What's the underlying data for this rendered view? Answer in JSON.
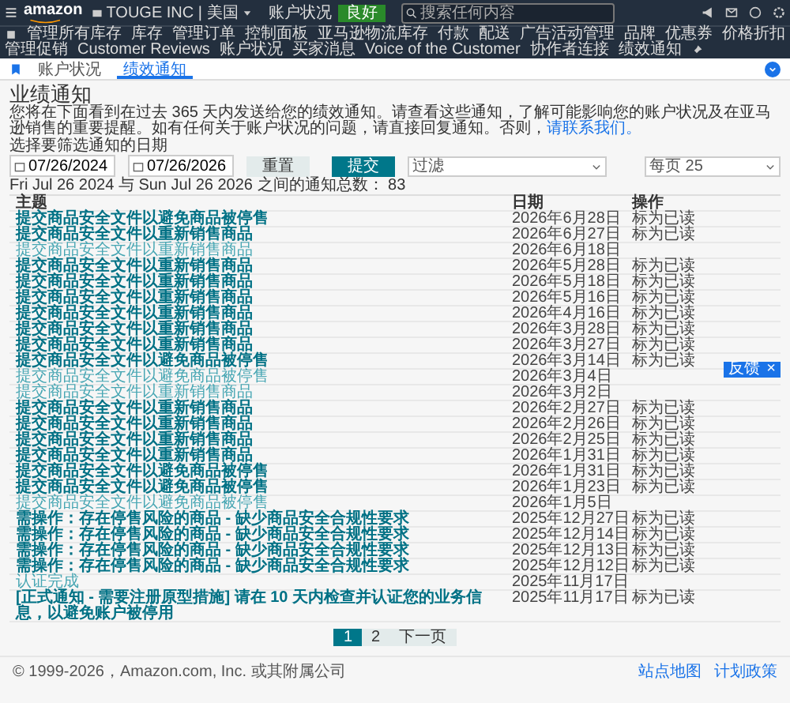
{
  "topbar": {
    "logo": "amazon",
    "store": "TOUGE INC | 美国",
    "health_label": "账户状况",
    "health_badge": "良好",
    "search": {
      "placeholder": "搜索任何内容"
    }
  },
  "nav": [
    "管理所有库存",
    "库存",
    "管理订单",
    "控制面板",
    "亚马逊物流库存",
    "付款",
    "配送",
    "广告活动管理",
    "品牌",
    "优惠券",
    "价格折扣",
    "管理促销",
    "Customer Reviews",
    "账户状况",
    "买家消息",
    "Voice of the Customer",
    "协作者连接",
    "绩效通知"
  ],
  "tabs": [
    {
      "label": "账户状况",
      "selected": false
    },
    {
      "label": "绩效通知",
      "selected": true
    }
  ],
  "page": {
    "title": "业绩通知",
    "description": "您将在下面看到在过去 365 天内发送给您的绩效通知。请查看这些通知，了解可能影响您的账户状况及在亚马逊销售的重要提醒。如有任何关于账户状况的问题，请直接回复通知。否则，",
    "description_link": "请联系我们。",
    "date_label": "选择要筛选通知的日期",
    "date_from": "07/26/2024",
    "date_to": "07/26/2026",
    "reset": "重置",
    "submit": "提交",
    "filter": "过滤",
    "per_page": "每页 25",
    "total": "Fri Jul 26 2024 与 Sun Jul 26 2026 之间的通知总数： 83"
  },
  "table": {
    "columns": [
      "主题",
      "日期",
      "操作"
    ],
    "rows": [
      {
        "subject": "提交商品安全文件以避免商品被停售",
        "date": "2026年6月28日",
        "action": "标为已读",
        "read": false
      },
      {
        "subject": "提交商品安全文件以重新销售商品",
        "date": "2026年6月27日",
        "action": "标为已读",
        "read": false
      },
      {
        "subject": "提交商品安全文件以重新销售商品",
        "date": "2026年6月18日",
        "read": true
      },
      {
        "subject": "提交商品安全文件以重新销售商品",
        "date": "2026年5月28日",
        "action": "标为已读",
        "read": false
      },
      {
        "subject": "提交商品安全文件以重新销售商品",
        "date": "2026年5月18日",
        "action": "标为已读",
        "read": false
      },
      {
        "subject": "提交商品安全文件以重新销售商品",
        "date": "2026年5月16日",
        "action": "标为已读",
        "read": false
      },
      {
        "subject": "提交商品安全文件以重新销售商品",
        "date": "2026年4月16日",
        "action": "标为已读",
        "read": false
      },
      {
        "subject": "提交商品安全文件以重新销售商品",
        "date": "2026年3月28日",
        "action": "标为已读",
        "read": false
      },
      {
        "subject": "提交商品安全文件以重新销售商品",
        "date": "2026年3月27日",
        "action": "标为已读",
        "read": false
      },
      {
        "subject": "提交商品安全文件以避免商品被停售",
        "date": "2026年3月14日",
        "action": "标为已读",
        "read": false
      },
      {
        "subject": "提交商品安全文件以避免商品被停售",
        "date": "2026年3月4日",
        "read": true
      },
      {
        "subject": "提交商品安全文件以重新销售商品",
        "date": "2026年3月2日",
        "read": true
      },
      {
        "subject": "提交商品安全文件以重新销售商品",
        "date": "2026年2月27日",
        "action": "标为已读",
        "read": false
      },
      {
        "subject": "提交商品安全文件以重新销售商品",
        "date": "2026年2月26日",
        "action": "标为已读",
        "read": false
      },
      {
        "subject": "提交商品安全文件以重新销售商品",
        "date": "2026年2月25日",
        "action": "标为已读",
        "read": false
      },
      {
        "subject": "提交商品安全文件以重新销售商品",
        "date": "2026年1月31日",
        "action": "标为已读",
        "read": false
      },
      {
        "subject": "提交商品安全文件以避免商品被停售",
        "date": "2026年1月31日",
        "action": "标为已读",
        "read": false
      },
      {
        "subject": "提交商品安全文件以避免商品被停售",
        "date": "2026年1月23日",
        "action": "标为已读",
        "read": false
      },
      {
        "subject": "提交商品安全文件以避免商品被停售",
        "date": "2026年1月5日",
        "read": true
      },
      {
        "subject": "需操作：存在停售风险的商品 - 缺少商品安全合规性要求",
        "date": "2025年12月27日",
        "action": "标为已读",
        "read": false
      },
      {
        "subject": "需操作：存在停售风险的商品 - 缺少商品安全合规性要求",
        "date": "2025年12月14日",
        "action": "标为已读",
        "read": false
      },
      {
        "subject": "需操作：存在停售风险的商品 - 缺少商品安全合规性要求",
        "date": "2025年12月13日",
        "action": "标为已读",
        "read": false
      },
      {
        "subject": "需操作：存在停售风险的商品 - 缺少商品安全合规性要求",
        "date": "2025年12月12日",
        "action": "标为已读",
        "read": false
      },
      {
        "subject": "认证完成",
        "date": "2025年11月17日",
        "read": true
      },
      {
        "subject": "[正式通知 - 需要注册原型措施] 请在 10 天内检查并认证您的业务信息，以避免账户被停用",
        "date": "2025年11月17日",
        "action": "标为已读",
        "read": false
      }
    ]
  },
  "pagination": [
    {
      "label": "1",
      "selected": true
    },
    {
      "label": "2",
      "selected": false
    },
    {
      "label": "下一页",
      "selected": false
    }
  ],
  "feedback": {
    "label": "反馈",
    "close": "×"
  },
  "footer": {
    "copyright": "© 1999-2026，Amazon.com, Inc. 或其附属公司",
    "links": [
      "站点地图",
      "计划政策"
    ]
  }
}
